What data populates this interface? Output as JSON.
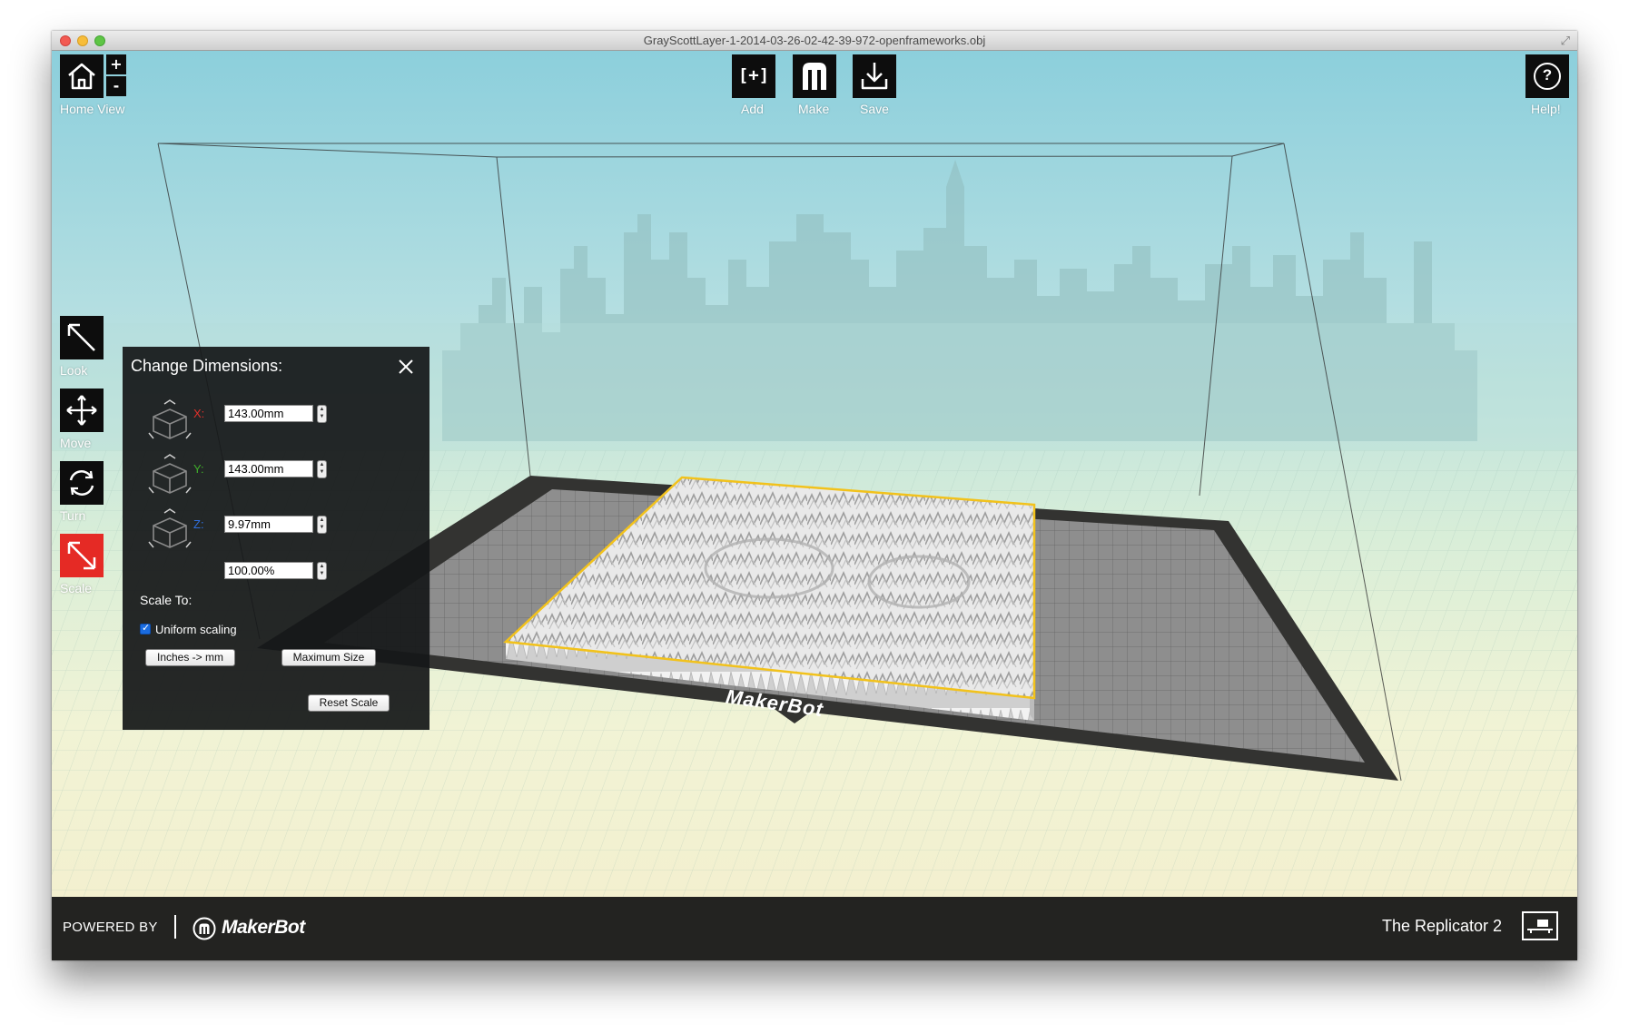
{
  "window": {
    "title": "GrayScottLayer-1-2014-03-26-02-42-39-972-openframeworks.obj"
  },
  "toolbar": {
    "home_view_label": "Home View",
    "zoom_in": "+",
    "zoom_out": "-",
    "add_label": "Add",
    "add_glyph": "[+]",
    "make_label": "Make",
    "save_label": "Save",
    "help_label": "Help!",
    "help_glyph": "?"
  },
  "tools": [
    {
      "label": "Look",
      "icon": "look-arrow-icon",
      "active": false
    },
    {
      "label": "Move",
      "icon": "move-cross-icon",
      "active": false
    },
    {
      "label": "Turn",
      "icon": "rotate-icon",
      "active": false
    },
    {
      "label": "Scale",
      "icon": "scale-arrow-icon",
      "active": true
    }
  ],
  "dimensions_panel": {
    "title": "Change Dimensions:",
    "x_axis": "X:",
    "x_value": "143.00mm",
    "y_axis": "Y:",
    "y_value": "143.00mm",
    "z_axis": "Z:",
    "z_value": "9.97mm",
    "scale_label": "Scale To:",
    "scale_value": "100.00%",
    "uniform_label": "Uniform scaling",
    "uniform_checked": true,
    "inches_button": "Inches -> mm",
    "max_size_button": "Maximum Size",
    "reset_button": "Reset Scale"
  },
  "build_plate": {
    "brand_text": "MakerBot"
  },
  "footer": {
    "powered_by": "POWERED BY",
    "brand": "MakerBot",
    "printer_name": "The Replicator 2"
  },
  "colors": {
    "active_tool": "#e52a25",
    "x_axis": "#e0302a",
    "y_axis": "#3fae2a",
    "z_axis": "#2f6fe0",
    "model_outline": "#f2c21b",
    "toolbar_button": "#0d0d0d"
  }
}
